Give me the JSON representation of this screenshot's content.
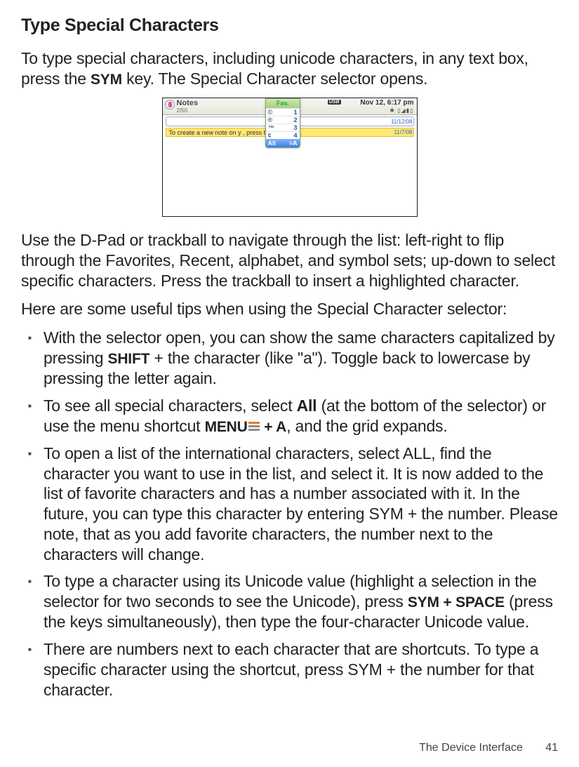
{
  "title": "Type Special Characters",
  "intro_parts": {
    "a": "To type special characters, including unicode characters, in any text box, press the ",
    "key": "SYM",
    "b": " key. The Special Character selector opens."
  },
  "para2": "Use the D-Pad or trackball to navigate through the list: left-right to flip through the Favorites, Recent, alphabet, and symbol sets; up-down to select specific characters. Press the trackball to insert a highlighted character.",
  "para3": "Here are some useful tips when using the Special Character selector:",
  "tips": [
    {
      "seg": [
        {
          "t": "With the selector open, you can show the same characters capitalized by pressing "
        },
        {
          "t": "SHIFT",
          "k": true
        },
        {
          "t": " + the character (like \"a\"). Toggle back to lowercase by pressing the letter again."
        }
      ]
    },
    {
      "seg": [
        {
          "t": "To see all special characters, select "
        },
        {
          "t": "All",
          "b": true
        },
        {
          "t": " (at the bottom of the selector) or use the menu shortcut "
        },
        {
          "t": "MENU",
          "k": true
        },
        {
          "t": " ",
          "icon": true
        },
        {
          "t": " + A",
          "k": true
        },
        {
          "t": ", and the grid expands."
        }
      ]
    },
    {
      "seg": [
        {
          "t": "To open a list of the international characters, select ALL, find the character you want to use in the list, and select it. It is now added to the list of favorite characters and has a number associated with it. In the future, you can type this character by entering SYM + the number. Please note, that as you add favorite characters, the number next to the characters will change."
        }
      ]
    },
    {
      "seg": [
        {
          "t": "To type a character using its Unicode value (highlight a selection in the selector for two seconds to see the Unicode), press "
        },
        {
          "t": "SYM + SPACE",
          "k": true
        },
        {
          "t": " (press the keys simultaneously), then type the four-character Unicode value."
        }
      ]
    },
    {
      "seg": [
        {
          "t": " There are numbers next to each character that are shortcuts. To type a specific character using the shortcut, press SYM + the number for that character."
        }
      ]
    }
  ],
  "screenshot": {
    "app_title": "Notes",
    "counter": "2/50",
    "usb": "USB",
    "clock": "Nov 12, 6:17 pm",
    "status_icons": "✱  ▯◢▮▯",
    "date1": "11/12/08",
    "date2": "11/7/08",
    "note_text": "To create a new note on y        , press the Menu b…",
    "popup": {
      "head": "Fav.",
      "rows": [
        {
          "sym": "©",
          "n": "1"
        },
        {
          "sym": "®",
          "n": "2"
        },
        {
          "sym": "™",
          "n": "3"
        },
        {
          "sym": "¢",
          "n": "4"
        }
      ],
      "foot_left": "All",
      "foot_right": "≡A"
    }
  },
  "footer": {
    "section": "The Device Interface",
    "page": "41"
  }
}
